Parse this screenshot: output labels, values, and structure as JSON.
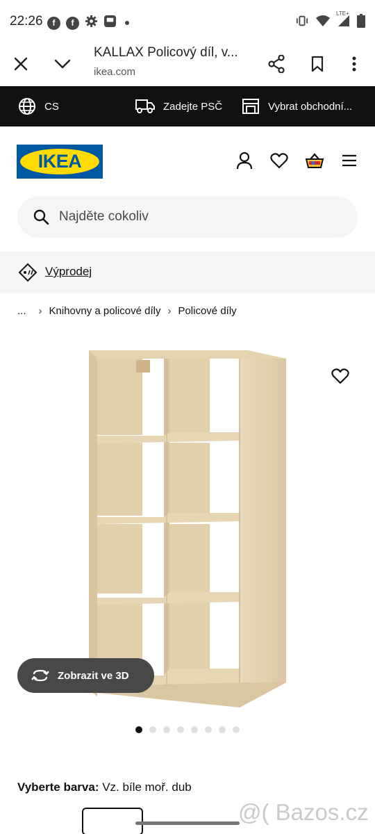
{
  "status_bar": {
    "time": "22:26",
    "network_label": "LTE+"
  },
  "browser": {
    "title": "KALLAX Policový díl, v...",
    "url": "ikea.com"
  },
  "top_strip": {
    "language": "CS",
    "postal_code": "Zadejte PSČ",
    "store": "Vybrat obchodní..."
  },
  "header": {
    "logo_text": "IKEA"
  },
  "search": {
    "placeholder": "Najděte cokoliv"
  },
  "sale_banner": {
    "label": "Výprodej"
  },
  "breadcrumb": {
    "ellipsis": "...",
    "items": [
      "Knihovny a policové díly",
      "Policové díly"
    ]
  },
  "product": {
    "view3d_label": "Zobrazit ve 3D",
    "image_count": 8,
    "active_image": 1,
    "color_label": "Vyberte barva:",
    "color_value": "Vz. bíle moř. dub"
  },
  "watermark": "@( Bazos.cz",
  "colors": {
    "ikea_blue": "#0058a3",
    "ikea_yellow": "#ffdb00",
    "strip_bg": "#111111",
    "wood": "#e6d4b5"
  }
}
